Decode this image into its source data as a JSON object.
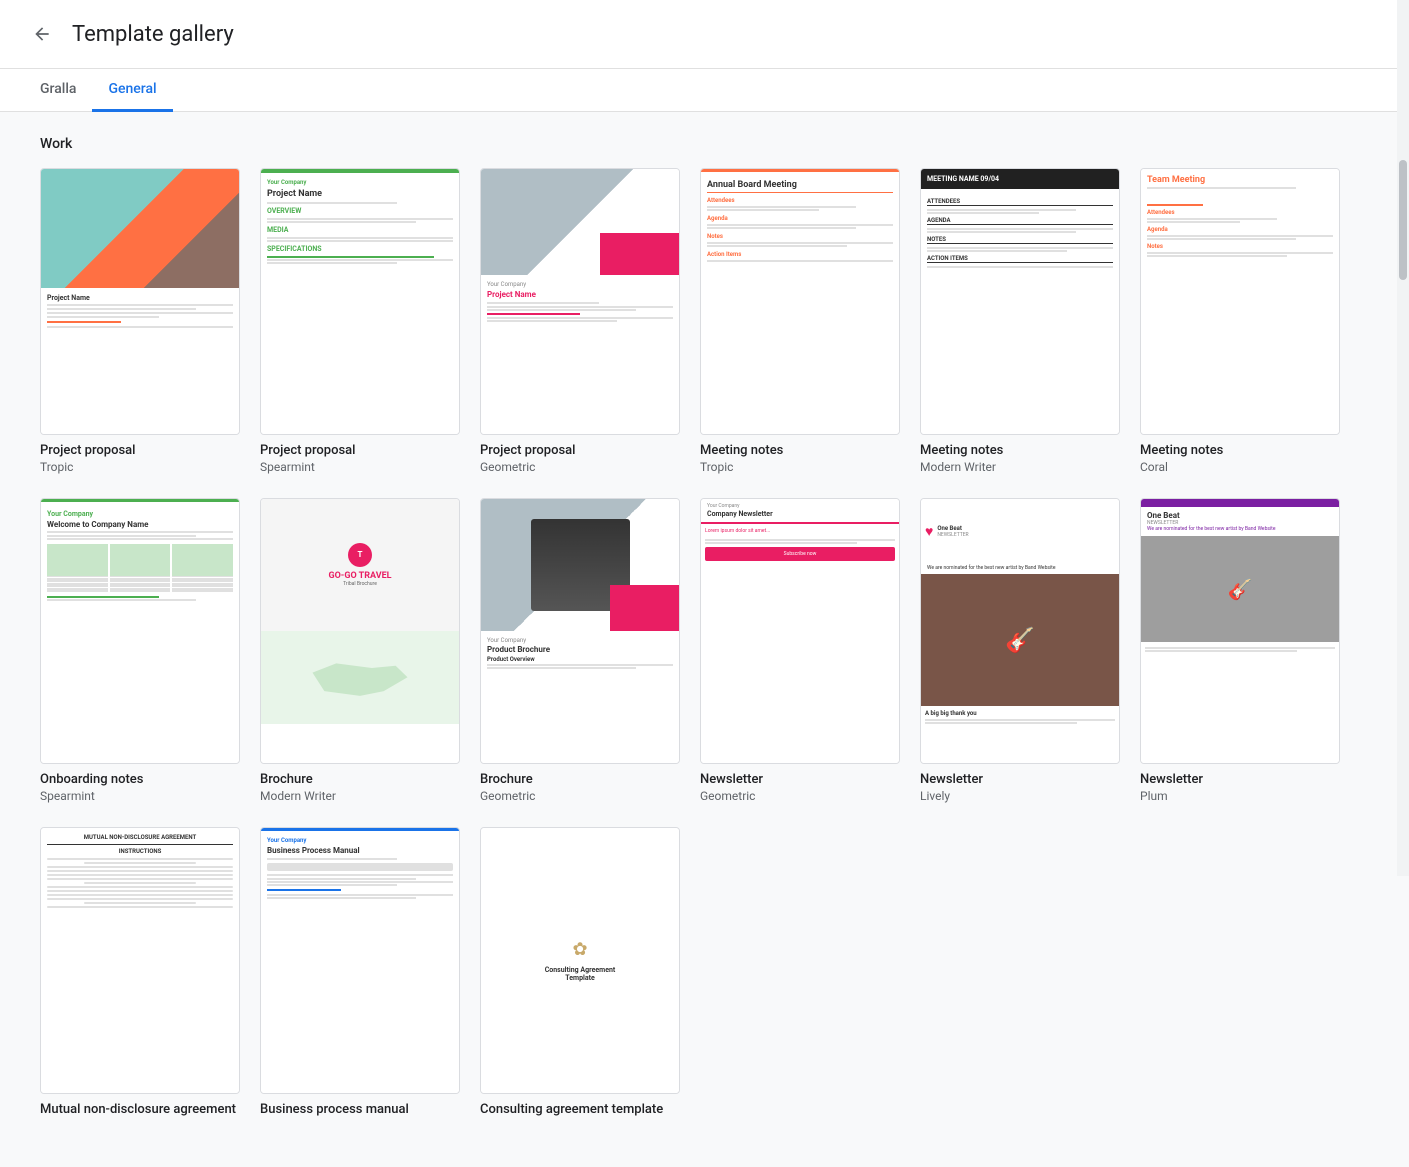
{
  "header": {
    "back_label": "←",
    "title": "Template gallery"
  },
  "tabs": [
    {
      "id": "gralla",
      "label": "Gralla",
      "active": false
    },
    {
      "id": "general",
      "label": "General",
      "active": true
    }
  ],
  "sections": [
    {
      "id": "work",
      "title": "Work",
      "rows": [
        {
          "cards": [
            {
              "id": "project-tropic",
              "name": "Project proposal",
              "sub": "Tropic",
              "tpl": "tropic"
            },
            {
              "id": "project-spearmint",
              "name": "Project proposal",
              "sub": "Spearmint",
              "tpl": "spearmint"
            },
            {
              "id": "project-geo",
              "name": "Project proposal",
              "sub": "Geometric",
              "tpl": "geo"
            },
            {
              "id": "meeting-tropic",
              "name": "Meeting notes",
              "sub": "Tropic",
              "tpl": "meeting-tropic"
            },
            {
              "id": "meeting-modern",
              "name": "Meeting notes",
              "sub": "Modern Writer",
              "tpl": "meeting-modern"
            },
            {
              "id": "meeting-coral",
              "name": "Meeting notes",
              "sub": "Coral",
              "tpl": "meeting-coral"
            }
          ]
        },
        {
          "cards": [
            {
              "id": "onboard-spearmint",
              "name": "Onboarding notes",
              "sub": "Spearmint",
              "tpl": "onboard"
            },
            {
              "id": "brochure-mw",
              "name": "Brochure",
              "sub": "Modern Writer",
              "tpl": "brochure-mw"
            },
            {
              "id": "brochure-geo",
              "name": "Brochure",
              "sub": "Geometric",
              "tpl": "brochure-geo"
            },
            {
              "id": "newsletter-geo",
              "name": "Newsletter",
              "sub": "Geometric",
              "tpl": "newsletter-geo"
            },
            {
              "id": "newsletter-lively",
              "name": "Newsletter",
              "sub": "Lively",
              "tpl": "newsletter-lively"
            },
            {
              "id": "newsletter-plum",
              "name": "Newsletter",
              "sub": "Plum",
              "tpl": "newsletter-plum"
            }
          ]
        },
        {
          "cards": [
            {
              "id": "nda",
              "name": "Mutual non-disclosure agreement",
              "sub": "",
              "tpl": "nda"
            },
            {
              "id": "business-process",
              "name": "Business process manual",
              "sub": "",
              "tpl": "business"
            },
            {
              "id": "consulting",
              "name": "Consulting agreement template",
              "sub": "",
              "tpl": "consulting"
            }
          ]
        }
      ]
    }
  ]
}
